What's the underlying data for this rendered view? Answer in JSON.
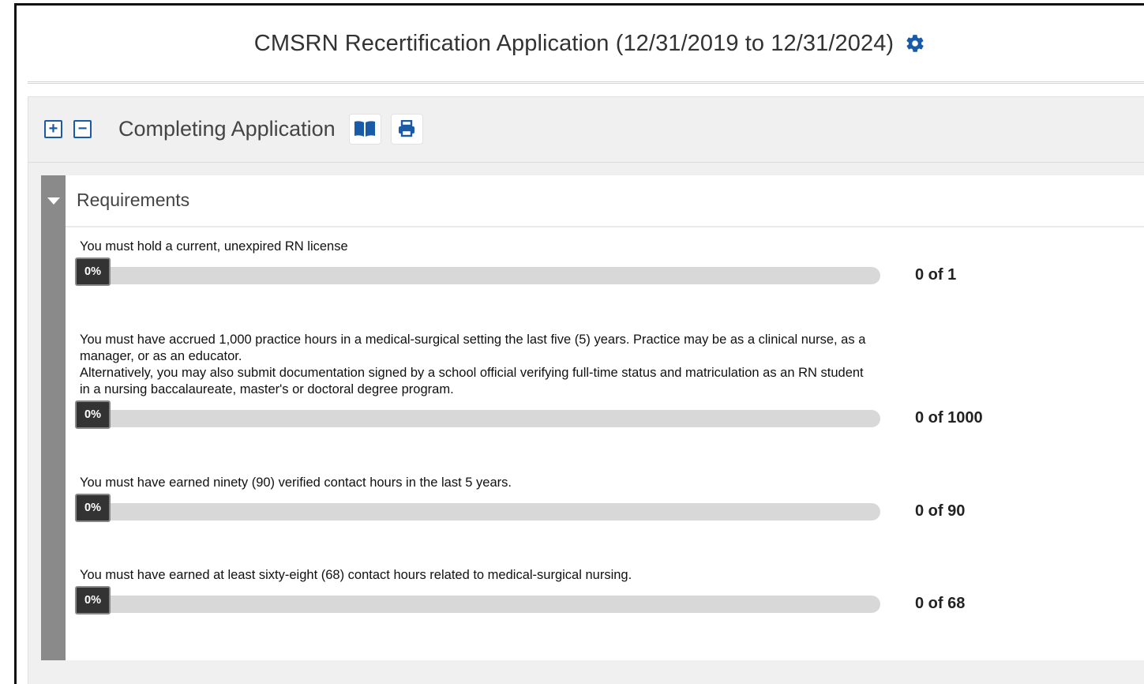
{
  "app": {
    "title": "CMSRN Recertification Application (12/31/2019 to 12/31/2024)",
    "settings_icon": "gear-icon"
  },
  "panel": {
    "title": "Completing Application",
    "expand_symbol": "+",
    "collapse_symbol": "−",
    "book_icon": "book-open-icon",
    "print_icon": "print-icon"
  },
  "requirements": {
    "title": "Requirements",
    "caret_icon": "caret-down-icon",
    "items": [
      {
        "text": "You must hold a current, unexpired RN license",
        "percent_label": "0%",
        "progress_fraction": 0,
        "count": "0 of 1"
      },
      {
        "text": "You must have accrued 1,000 practice hours in a medical-surgical setting the last five (5) years. Practice may be as a clinical nurse, as a manager, or as an educator.",
        "text_2": "Alternatively, you may also submit documentation signed by a school official verifying full-time status and matriculation as an RN student in a nursing baccalaureate, master's or doctoral degree program.",
        "percent_label": "0%",
        "progress_fraction": 0,
        "count": "0 of 1000"
      },
      {
        "text": "You must have earned ninety (90) verified contact hours in the last 5 years.",
        "percent_label": "0%",
        "progress_fraction": 0,
        "count": "0 of 90"
      },
      {
        "text": "You must have earned at least sixty-eight (68) contact hours related to medical-surgical nursing.",
        "percent_label": "0%",
        "progress_fraction": 0,
        "count": "0 of 68"
      }
    ]
  },
  "colors": {
    "accent_blue": "#1a5ba8",
    "stripe_gray": "#8a8a8a",
    "track_gray": "#d8d8d8",
    "badge_dark": "#333333"
  }
}
